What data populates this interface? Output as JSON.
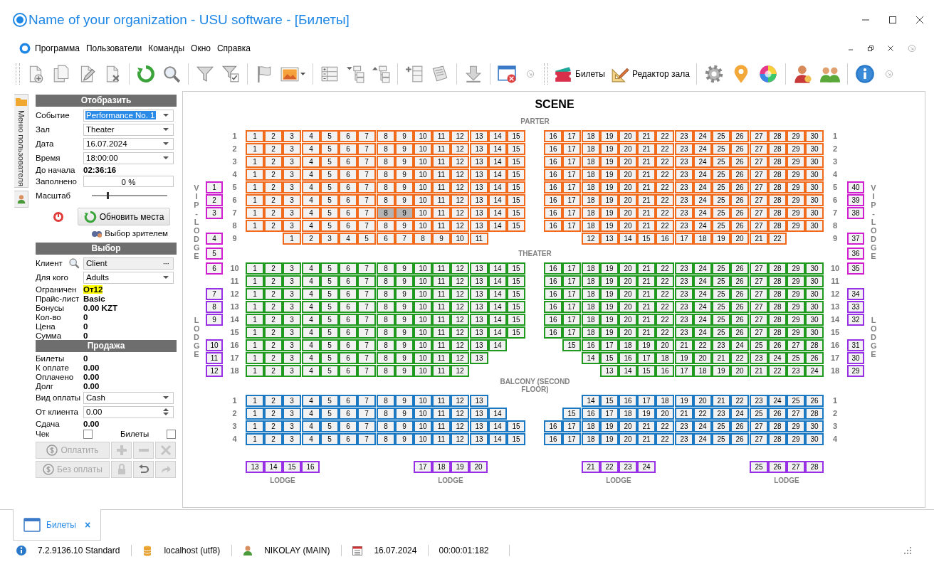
{
  "window": {
    "title": "Name of your organization - USU software - [Билеты]"
  },
  "menu": [
    "Программа",
    "Пользователи",
    "Команды",
    "Окно",
    "Справка"
  ],
  "toolbar": {
    "buttons": [
      {
        "label": "Билеты"
      },
      {
        "label": "Редактор зала"
      }
    ]
  },
  "side_tab": {
    "label": "Меню пользователя"
  },
  "panel": {
    "sections": [
      {
        "title": "Отобразить",
        "fields": [
          {
            "kind": "dropdown",
            "label": "Событие",
            "value": "Performance No. 1",
            "focused": true
          },
          {
            "kind": "dropdown",
            "label": "Зал",
            "value": "Theater",
            "focused": false
          },
          {
            "kind": "dropdown",
            "label": "Дата",
            "value": "16.07.2024",
            "focused": false
          },
          {
            "kind": "dropdown",
            "label": "Время",
            "value": "18:00:00",
            "focused": false
          },
          {
            "kind": "value",
            "label": "До начала",
            "value": "02:36:16",
            "highlight": false
          },
          {
            "kind": "box",
            "label": "Заполнено",
            "value": "0 %"
          },
          {
            "kind": "slider",
            "label": "Масштаб",
            "level": 0.2
          }
        ]
      },
      {
        "title": "Выбор",
        "fields": [
          {
            "kind": "lookup",
            "label": "Клиент",
            "value": "Client",
            "more": "···"
          },
          {
            "kind": "dropdown",
            "label": "Для кого",
            "value": "Adults",
            "focused": false
          },
          {
            "kind": "value",
            "label": "Ограничен",
            "value": "От12",
            "highlight": true
          },
          {
            "kind": "value",
            "label": "Прайс-лист",
            "value": "Basic",
            "highlight": false
          },
          {
            "kind": "value",
            "label": "Бонусы",
            "value": "0.00 KZT",
            "highlight": false
          },
          {
            "kind": "value",
            "label": "Кол-во",
            "value": "0",
            "highlight": false
          },
          {
            "kind": "value",
            "label": "Цена",
            "value": "0",
            "highlight": false
          },
          {
            "kind": "value",
            "label": "Сумма",
            "value": "0",
            "highlight": false
          }
        ]
      },
      {
        "title": "Продажа",
        "fields": [
          {
            "kind": "value",
            "label": "Билеты",
            "value": "0",
            "highlight": false
          },
          {
            "kind": "value",
            "label": "К оплате",
            "value": "0.00",
            "highlight": false
          },
          {
            "kind": "value",
            "label": "Оплачено",
            "value": "0.00",
            "highlight": false
          },
          {
            "kind": "value",
            "label": "Долг",
            "value": "0.00",
            "highlight": false
          },
          {
            "kind": "dropdown",
            "label": "Вид оплаты",
            "value": "Cash",
            "focused": false
          },
          {
            "kind": "spin",
            "label": "От клиента",
            "value": "0.00"
          },
          {
            "kind": "value",
            "label": "Сдача",
            "value": "0.00",
            "highlight": false
          }
        ]
      }
    ],
    "refresh": {
      "label": "Обновить места"
    },
    "viewer_link": {
      "label": "Выбор зрителем"
    },
    "checks": [
      {
        "label": "Чек",
        "checked": false
      },
      {
        "label": "Билеты",
        "checked": false
      }
    ],
    "pay_buttons": [
      {
        "label": "Оплатить",
        "disabled": true
      },
      {
        "label": "Без оплаты",
        "disabled": true
      }
    ],
    "tool_buttons": [
      {
        "disabled": true
      },
      {
        "disabled": true
      },
      {
        "disabled": true
      },
      {
        "disabled": true
      },
      {
        "disabled": false
      },
      {
        "disabled": true
      }
    ]
  },
  "map": {
    "title": "SCENE",
    "sections": [
      {
        "title": "PARTER",
        "color": "#f26a1c",
        "rows": [
          {
            "label": "1",
            "end_label": "1",
            "left": {
              "b1": [
                "1",
                "2",
                "3"
              ],
              "b2": [
                "4",
                "5",
                "6",
                "7"
              ],
              "b3": [
                "8",
                "9",
                "10",
                "11",
                "12"
              ],
              "b4": [
                "13",
                "14",
                "15"
              ]
            },
            "right": {
              "b1": [
                "16",
                "17"
              ],
              "b2": [
                "18",
                "19",
                "20",
                "21",
                "22"
              ],
              "b3": [
                "23",
                "24",
                "25",
                "26"
              ],
              "b4": [
                "27",
                "28",
                "29",
                "30"
              ]
            }
          },
          {
            "label": "2",
            "end_label": "2",
            "left": {
              "b1": [
                "1",
                "2",
                "3"
              ],
              "b2": [
                "4",
                "5",
                "6",
                "7"
              ],
              "b3": [
                "8",
                "9",
                "10",
                "11",
                "12"
              ],
              "b4": [
                "13",
                "14",
                "15"
              ]
            },
            "right": {
              "b1": [
                "16",
                "17"
              ],
              "b2": [
                "18",
                "19",
                "20",
                "21",
                "22"
              ],
              "b3": [
                "23",
                "24",
                "25",
                "26"
              ],
              "b4": [
                "27",
                "28",
                "29",
                "30"
              ]
            }
          },
          {
            "label": "3",
            "end_label": "3",
            "left": {
              "b1": [
                "1",
                "2",
                "3"
              ],
              "b2": [
                "4",
                "5",
                "6",
                "7"
              ],
              "b3": [
                "8",
                "9",
                "10",
                "11",
                "12"
              ],
              "b4": [
                "13",
                "14",
                "15"
              ]
            },
            "right": {
              "b1": [
                "16",
                "17"
              ],
              "b2": [
                "18",
                "19",
                "20",
                "21",
                "22"
              ],
              "b3": [
                "23",
                "24",
                "25",
                "26"
              ],
              "b4": [
                "27",
                "28",
                "29",
                "30"
              ]
            }
          },
          {
            "label": "4",
            "end_label": "4",
            "left": {
              "b1": [
                "1",
                "2",
                "3"
              ],
              "b2": [
                "4",
                "5",
                "6",
                "7"
              ],
              "b3": [
                "8",
                "9",
                "10",
                "11",
                "12"
              ],
              "b4": [
                "13",
                "14",
                "15"
              ]
            },
            "right": {
              "b1": [
                "16",
                "17"
              ],
              "b2": [
                "18",
                "19",
                "20",
                "21",
                "22"
              ],
              "b3": [
                "23",
                "24",
                "25",
                "26"
              ],
              "b4": [
                "27",
                "28",
                "29",
                "30"
              ]
            }
          },
          {
            "label": "5",
            "end_label": "5",
            "side_left": "VIP-LODGE",
            "side_right": "VIP-LODGE",
            "lodge_left": {
              "label": "1",
              "color": "#d01fd0"
            },
            "lodge_right": {
              "label": "40",
              "color": "#d01fd0"
            },
            "left": {
              "b1": [
                "1",
                "2",
                "3"
              ],
              "b2": [
                "4",
                "5",
                "6",
                "7"
              ],
              "b3": [
                "8",
                "9",
                "10",
                "11",
                "12"
              ],
              "b4": [
                "13",
                "14",
                "15"
              ]
            },
            "right": {
              "b1": [
                "16",
                "17"
              ],
              "b2": [
                "18",
                "19",
                "20",
                "21",
                "22"
              ],
              "b3": [
                "23",
                "24",
                "25",
                "26"
              ],
              "b4": [
                "27",
                "28",
                "29",
                "30"
              ]
            }
          },
          {
            "label": "6",
            "end_label": "6",
            "lodge_left": {
              "label": "2",
              "color": "#d01fd0"
            },
            "lodge_right": {
              "label": "39",
              "color": "#d01fd0"
            },
            "left": {
              "b1": [
                "1",
                "2",
                "3"
              ],
              "b2": [
                "4",
                "5",
                "6",
                "7"
              ],
              "b3": [
                "8",
                "9",
                "10",
                "11",
                "12"
              ],
              "b4": [
                "13",
                "14",
                "15"
              ]
            },
            "right": {
              "b1": [
                "16",
                "17"
              ],
              "b2": [
                "18",
                "19",
                "20",
                "21",
                "22"
              ],
              "b3": [
                "23",
                "24",
                "25",
                "26"
              ],
              "b4": [
                "27",
                "28",
                "29",
                "30"
              ]
            }
          },
          {
            "label": "7",
            "end_label": "7",
            "lodge_left": {
              "label": "3",
              "color": "#d01fd0"
            },
            "lodge_right": {
              "label": "38",
              "color": "#d01fd0"
            },
            "left": {
              "b1": [
                "1",
                "2",
                "3"
              ],
              "b2": [
                "4",
                "5",
                "6",
                "7"
              ],
              "b3": [
                {
                  "label": "8",
                  "selected": true
                },
                {
                  "label": "9",
                  "selected": true
                },
                "10",
                "11",
                "12"
              ],
              "b4": [
                "13",
                "14",
                "15"
              ]
            },
            "right": {
              "b1": [
                "16",
                "17"
              ],
              "b2": [
                "18",
                "19",
                "20",
                "21",
                "22"
              ],
              "b3": [
                "23",
                "24",
                "25",
                "26"
              ],
              "b4": [
                "27",
                "28",
                "29",
                "30"
              ]
            }
          },
          {
            "label": "8",
            "end_label": "8",
            "left": {
              "b1": [
                "1",
                "2",
                "3"
              ],
              "b2": [
                "4",
                "5",
                "6",
                "7"
              ],
              "b3": [
                "8",
                "9",
                "10",
                "11",
                "12"
              ],
              "b4": [
                "13",
                "14",
                "15"
              ]
            },
            "right": {
              "b1": [
                "16",
                "17"
              ],
              "b2": [
                "18",
                "19",
                "20",
                "21",
                "22"
              ],
              "b3": [
                "23",
                "24",
                "25",
                "26"
              ],
              "b4": [
                "27",
                "28",
                "29",
                "30"
              ]
            }
          },
          {
            "label": "9",
            "end_label": "9",
            "lodge_left": {
              "label": "4",
              "color": "#d01fd0"
            },
            "lodge_right": {
              "label": "37",
              "color": "#d01fd0"
            },
            "left": {
              "b1": [
                "1"
              ],
              "b2": [
                "2",
                "3",
                "4",
                "5"
              ],
              "b3": [
                "6",
                "7",
                "8",
                "9",
                "10"
              ],
              "b4": [
                "11"
              ]
            },
            "right": {
              "b2": [
                "12",
                "13",
                "14",
                "15",
                "16"
              ],
              "b3": [
                "17",
                "18",
                "19",
                "20"
              ],
              "b4": [
                "21",
                "22"
              ]
            }
          }
        ]
      },
      {
        "title": "THEATER",
        "color": "#1f9a1f",
        "title_lodge_left": {
          "label": "5",
          "color": "#d01fd0"
        },
        "title_lodge_right": {
          "label": "36",
          "color": "#d01fd0"
        },
        "rows": [
          {
            "label": "10",
            "end_label": "10",
            "lodge_left": {
              "label": "6",
              "color": "#d01fd0"
            },
            "lodge_right": {
              "label": "35",
              "color": "#d01fd0"
            },
            "left": {
              "b1": [
                "1",
                "2",
                "3"
              ],
              "b2": [
                "4",
                "5",
                "6",
                "7"
              ],
              "b3": [
                "8",
                "9",
                "10",
                "11",
                "12"
              ],
              "b4": [
                "13",
                "14",
                "15"
              ]
            },
            "right": {
              "b1": [
                "16",
                "17"
              ],
              "b2": [
                "18",
                "19",
                "20",
                "21",
                "22"
              ],
              "b3": [
                "23",
                "24",
                "25",
                "26"
              ],
              "b4": [
                "27",
                "28",
                "29",
                "30"
              ]
            }
          },
          {
            "label": "11",
            "end_label": "11",
            "left": {
              "b1": [
                "1",
                "2",
                "3"
              ],
              "b2": [
                "4",
                "5",
                "6",
                "7"
              ],
              "b3": [
                "8",
                "9",
                "10",
                "11",
                "12"
              ],
              "b4": [
                "13",
                "14",
                "15"
              ]
            },
            "right": {
              "b1": [
                "16",
                "17"
              ],
              "b2": [
                "18",
                "19",
                "20",
                "21",
                "22"
              ],
              "b3": [
                "23",
                "24",
                "25",
                "26"
              ],
              "b4": [
                "27",
                "28",
                "29",
                "30"
              ]
            }
          },
          {
            "label": "12",
            "end_label": "12",
            "lodge_left": {
              "label": "7",
              "color": "#9830e6"
            },
            "lodge_right": {
              "label": "34",
              "color": "#9830e6"
            },
            "left": {
              "b1": [
                "1",
                "2",
                "3"
              ],
              "b2": [
                "4",
                "5",
                "6",
                "7"
              ],
              "b3": [
                "8",
                "9",
                "10",
                "11",
                "12"
              ],
              "b4": [
                "13",
                "14",
                "15"
              ]
            },
            "right": {
              "b1": [
                "16",
                "17"
              ],
              "b2": [
                "18",
                "19",
                "20",
                "21",
                "22"
              ],
              "b3": [
                "23",
                "24",
                "25",
                "26"
              ],
              "b4": [
                "27",
                "28",
                "29",
                "30"
              ]
            }
          },
          {
            "label": "13",
            "end_label": "13",
            "lodge_left": {
              "label": "8",
              "color": "#9830e6"
            },
            "lodge_right": {
              "label": "33",
              "color": "#9830e6"
            },
            "left": {
              "b1": [
                "1",
                "2",
                "3"
              ],
              "b2": [
                "4",
                "5",
                "6",
                "7"
              ],
              "b3": [
                "8",
                "9",
                "10",
                "11",
                "12"
              ],
              "b4": [
                "13",
                "14",
                "15"
              ]
            },
            "right": {
              "b1": [
                "16",
                "17"
              ],
              "b2": [
                "18",
                "19",
                "20",
                "21",
                "22"
              ],
              "b3": [
                "23",
                "24",
                "25",
                "26"
              ],
              "b4": [
                "27",
                "28",
                "29",
                "30"
              ]
            }
          },
          {
            "label": "14",
            "end_label": "14",
            "side_left": "LODGE",
            "side_right": "LODGE",
            "lodge_left": {
              "label": "9",
              "color": "#9830e6"
            },
            "lodge_right": {
              "label": "32",
              "color": "#9830e6"
            },
            "left": {
              "b1": [
                "1",
                "2",
                "3"
              ],
              "b2": [
                "4",
                "5",
                "6",
                "7"
              ],
              "b3": [
                "8",
                "9",
                "10",
                "11",
                "12"
              ],
              "b4": [
                "13",
                "14",
                "15"
              ]
            },
            "right": {
              "b1": [
                "16",
                "17"
              ],
              "b2": [
                "18",
                "19",
                "20",
                "21",
                "22"
              ],
              "b3": [
                "23",
                "24",
                "25",
                "26"
              ],
              "b4": [
                "27",
                "28",
                "29",
                "30"
              ]
            }
          },
          {
            "label": "15",
            "end_label": "15",
            "left": {
              "b1": [
                "1",
                "2",
                "3"
              ],
              "b2": [
                "4",
                "5",
                "6",
                "7"
              ],
              "b3": [
                "8",
                "9",
                "10",
                "11",
                "12"
              ],
              "b4": [
                "13",
                "14",
                "15"
              ]
            },
            "right": {
              "b1": [
                "16",
                "17"
              ],
              "b2": [
                "18",
                "19",
                "20",
                "21",
                "22"
              ],
              "b3": [
                "23",
                "24",
                "25",
                "26"
              ],
              "b4": [
                "27",
                "28",
                "29",
                "30"
              ]
            }
          },
          {
            "label": "16",
            "end_label": "16",
            "lodge_left": {
              "label": "10",
              "color": "#9830e6"
            },
            "lodge_right": {
              "label": "31",
              "color": "#9830e6"
            },
            "left": {
              "b1": [
                "1",
                "2",
                "3"
              ],
              "b2": [
                "4",
                "5",
                "6",
                "7"
              ],
              "b3": [
                "8",
                "9",
                "10",
                "11",
                "12"
              ],
              "b4": [
                "13",
                "14"
              ]
            },
            "right": {
              "b1": [
                "15"
              ],
              "b2": [
                "16",
                "17",
                "18",
                "19",
                "20"
              ],
              "b3": [
                "21",
                "22",
                "23",
                "24"
              ],
              "b4": [
                "25",
                "26",
                "27",
                "28"
              ]
            }
          },
          {
            "label": "17",
            "end_label": "17",
            "lodge_left": {
              "label": "11",
              "color": "#9830e6"
            },
            "lodge_right": {
              "label": "30",
              "color": "#9830e6"
            },
            "left": {
              "b1": [
                "1",
                "2",
                "3"
              ],
              "b2": [
                "4",
                "5",
                "6",
                "7"
              ],
              "b3": [
                "8",
                "9",
                "10",
                "11",
                "12"
              ],
              "b4": [
                "13"
              ]
            },
            "right": {
              "b2": [
                "14",
                "15",
                "16",
                "17",
                "18"
              ],
              "b3": [
                "19",
                "20",
                "21",
                "22"
              ],
              "b4": [
                "23",
                "24",
                "25",
                "26"
              ]
            }
          },
          {
            "label": "18",
            "end_label": "18",
            "lodge_left": {
              "label": "12",
              "color": "#9830e6"
            },
            "lodge_right": {
              "label": "29",
              "color": "#9830e6"
            },
            "left": {
              "b1": [
                "1",
                "2",
                "3"
              ],
              "b2": [
                "4",
                "5",
                "6",
                "7"
              ],
              "b3": [
                "8",
                "9",
                "10",
                "11",
                "12"
              ]
            },
            "right": {
              "b2": [
                "13",
                "14",
                "15",
                "16"
              ],
              "b3": [
                "17",
                "18",
                "19",
                "20"
              ],
              "b4": [
                "21",
                "22",
                "23",
                "24"
              ]
            }
          }
        ]
      },
      {
        "title": "BALCONY (SECOND FLOOR)",
        "color": "#1b78c2",
        "rows": [
          {
            "label": "1",
            "end_label": "1",
            "left": {
              "b1": [
                "1",
                "2",
                "3"
              ],
              "b2": [
                "4",
                "5",
                "6",
                "7"
              ],
              "b3": [
                "8",
                "9",
                "10",
                "11",
                "12"
              ],
              "b4": [
                "13"
              ]
            },
            "right": {
              "b2": [
                "14",
                "15",
                "16",
                "17",
                "18"
              ],
              "b3": [
                "19",
                "20",
                "21",
                "22"
              ],
              "b4": [
                "23",
                "24",
                "25",
                "26"
              ]
            }
          },
          {
            "label": "2",
            "end_label": "2",
            "left": {
              "b1": [
                "1",
                "2",
                "3"
              ],
              "b2": [
                "4",
                "5",
                "6",
                "7"
              ],
              "b3": [
                "8",
                "9",
                "10",
                "11",
                "12"
              ],
              "b4": [
                "13",
                "14"
              ]
            },
            "right": {
              "b1": [
                "15"
              ],
              "b2": [
                "16",
                "17",
                "18",
                "19",
                "20"
              ],
              "b3": [
                "21",
                "22",
                "23",
                "24"
              ],
              "b4": [
                "25",
                "26",
                "27",
                "28"
              ]
            }
          },
          {
            "label": "3",
            "end_label": "3",
            "left": {
              "b1": [
                "1",
                "2",
                "3"
              ],
              "b2": [
                "4",
                "5",
                "6",
                "7"
              ],
              "b3": [
                "8",
                "9",
                "10",
                "11",
                "12"
              ],
              "b4": [
                "13",
                "14",
                "15"
              ]
            },
            "right": {
              "b1": [
                "16",
                "17"
              ],
              "b2": [
                "18",
                "19",
                "20",
                "21",
                "22"
              ],
              "b3": [
                "23",
                "24",
                "25",
                "26"
              ],
              "b4": [
                "27",
                "28",
                "29",
                "30"
              ]
            }
          },
          {
            "label": "4",
            "end_label": "4",
            "left": {
              "b1": [
                "1",
                "2",
                "3"
              ],
              "b2": [
                "4",
                "5",
                "6",
                "7"
              ],
              "b3": [
                "8",
                "9",
                "10",
                "11",
                "12"
              ],
              "b4": [
                "13",
                "14",
                "15"
              ]
            },
            "right": {
              "b1": [
                "16",
                "17"
              ],
              "b2": [
                "18",
                "19",
                "20",
                "21",
                "22"
              ],
              "b3": [
                "23",
                "24",
                "25",
                "26"
              ],
              "b4": [
                "27",
                "28",
                "29",
                "30"
              ]
            }
          }
        ]
      }
    ],
    "bottom_lodges": [
      {
        "seats": [
          "13",
          "14",
          "15",
          "16"
        ],
        "label": "LODGE",
        "color": "#9830e6"
      },
      {
        "seats": [
          "17",
          "18",
          "19",
          "20"
        ],
        "label": "LODGE",
        "color": "#9830e6"
      },
      {
        "seats": [
          "21",
          "22",
          "23",
          "24"
        ],
        "label": "LODGE",
        "color": "#9830e6"
      },
      {
        "seats": [
          "25",
          "26",
          "27",
          "28"
        ],
        "label": "LODGE",
        "color": "#9830e6"
      }
    ]
  },
  "doc_tabs": [
    {
      "label": "Билеты",
      "selected": true,
      "close": "×"
    }
  ],
  "status_bar": [
    "7.2.9136.10 Standard",
    "localhost (utf8)",
    "NIKOLAY (MAIN)",
    "16.07.2024",
    "00:00:01:182"
  ]
}
